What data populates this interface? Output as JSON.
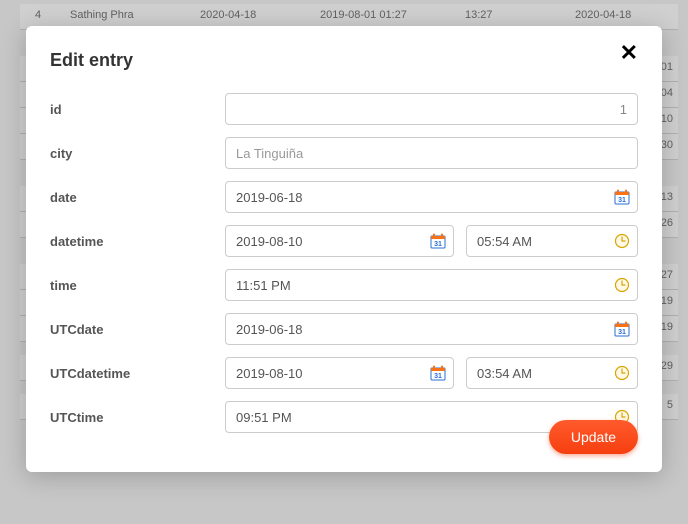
{
  "background": {
    "row0": {
      "idx": "4",
      "city": "Sathing Phra",
      "date": "2020-04-18",
      "datetime": "2019-08-01 01:27",
      "time": "13:27",
      "utcdate": "2020-04-18"
    },
    "frags": [
      "01",
      "04",
      "10",
      "30",
      "13",
      "26",
      "27",
      "19",
      "19",
      "29",
      "5"
    ]
  },
  "modal": {
    "title": "Edit entry",
    "fields": {
      "id": {
        "label": "id",
        "value": "1"
      },
      "city": {
        "label": "city",
        "value": "La Tinguiña"
      },
      "date": {
        "label": "date",
        "value": "2019-06-18"
      },
      "datetime": {
        "label": "datetime",
        "date_value": "2019-08-10",
        "time_value": "05:54 AM"
      },
      "time": {
        "label": "time",
        "value": "11:51 PM"
      },
      "utcdate": {
        "label": "UTCdate",
        "value": "2019-06-18"
      },
      "utcdatetime": {
        "label": "UTCdatetime",
        "date_value": "2019-08-10",
        "time_value": "03:54 AM"
      },
      "utctime": {
        "label": "UTCtime",
        "value": "09:51 PM"
      }
    },
    "update_label": "Update"
  }
}
